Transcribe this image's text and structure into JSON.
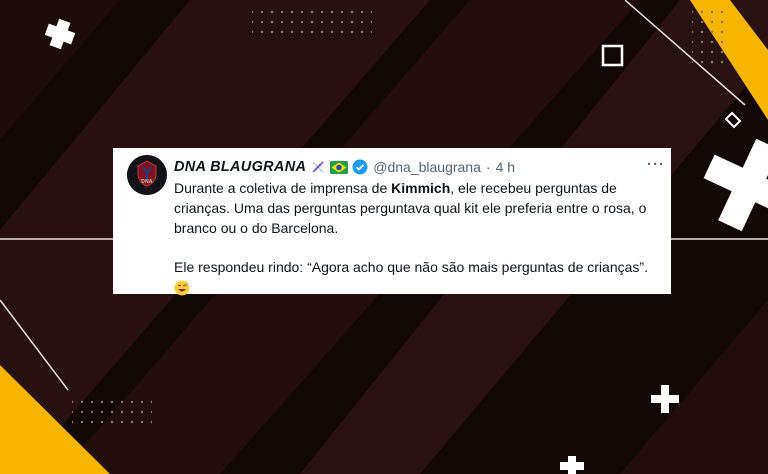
{
  "tweet": {
    "display_name": "DNA BLAUGRANA",
    "avatar_text": "DNA",
    "handle": "@dna_blaugrana",
    "separator": "·",
    "time": "4 h",
    "more": "···",
    "p1_a": "Durante a coletiva de imprensa de ",
    "p1_bold": "Kimmich",
    "p1_b": ", ele recebeu perguntas de crianças. Uma das perguntas perguntava qual kit ele preferia entre o rosa, o branco ou o do Barcelona.",
    "p2": "Ele respondeu rindo: “Agora acho que não são mais perguntas de crianças”.",
    "emoji": "grinning-face-with-sweat"
  },
  "decor": {
    "accent": "#f7b500",
    "background": "#120806"
  }
}
